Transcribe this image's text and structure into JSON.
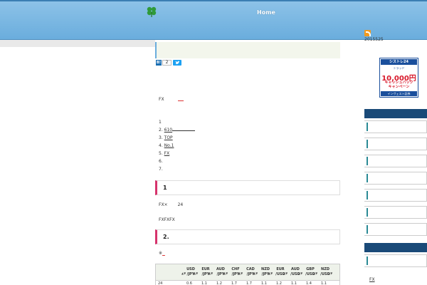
{
  "header": {
    "nav_home": "Home",
    "logo_icon": "clover-icon"
  },
  "share": {
    "hatena_label": "B!",
    "count": "2",
    "tweet_label": "t"
  },
  "intro": {
    "text": "FX"
  },
  "toc": [
    {
      "num": "1",
      "text": ""
    },
    {
      "num": "2.",
      "text": "610"
    },
    {
      "num": "3.",
      "text": "TOP"
    },
    {
      "num": "4.",
      "text": "No.1"
    },
    {
      "num": "5.",
      "text": "FX"
    },
    {
      "num": "6.",
      "text": ""
    },
    {
      "num": "7.",
      "text": ""
    }
  ],
  "section1": {
    "title": "1",
    "p1_a": "FX×",
    "p1_b": "24",
    "p2": "FXFXFX"
  },
  "section2": {
    "title": "2.",
    "note": "※"
  },
  "table": {
    "headers": [
      "USD\n/JPY",
      "EUR\n/JPY",
      "AUD\n/JPY",
      "CHF\n/JPY",
      "CAD\n/JPY",
      "NZD\n/JPY",
      "EUR\n/USD",
      "AUD\n/USD",
      "GBP\n/USD",
      "NZD\n/USD"
    ],
    "row_label": "24",
    "row_values": [
      "0.6",
      "1.1",
      "1.2",
      "1.7",
      "1.7",
      "1.1",
      "1.2",
      "1.1",
      "1.4",
      "1.1"
    ]
  },
  "sidebar": {
    "rss_date": "2015525",
    "banner": {
      "top": "シストレ24",
      "sub": "トラッド",
      "amount": "10,000円",
      "cb1": "キャッシュバック",
      "cb2": "キャンペーン",
      "bottom": "インヴェスト証券"
    },
    "fx_link": "FX"
  },
  "colors": {
    "header": "#7ab8e3",
    "accent_pink": "#d6336c",
    "sidebar_head": "#1a4a78",
    "sidebar_bar": "#2a8a95"
  }
}
